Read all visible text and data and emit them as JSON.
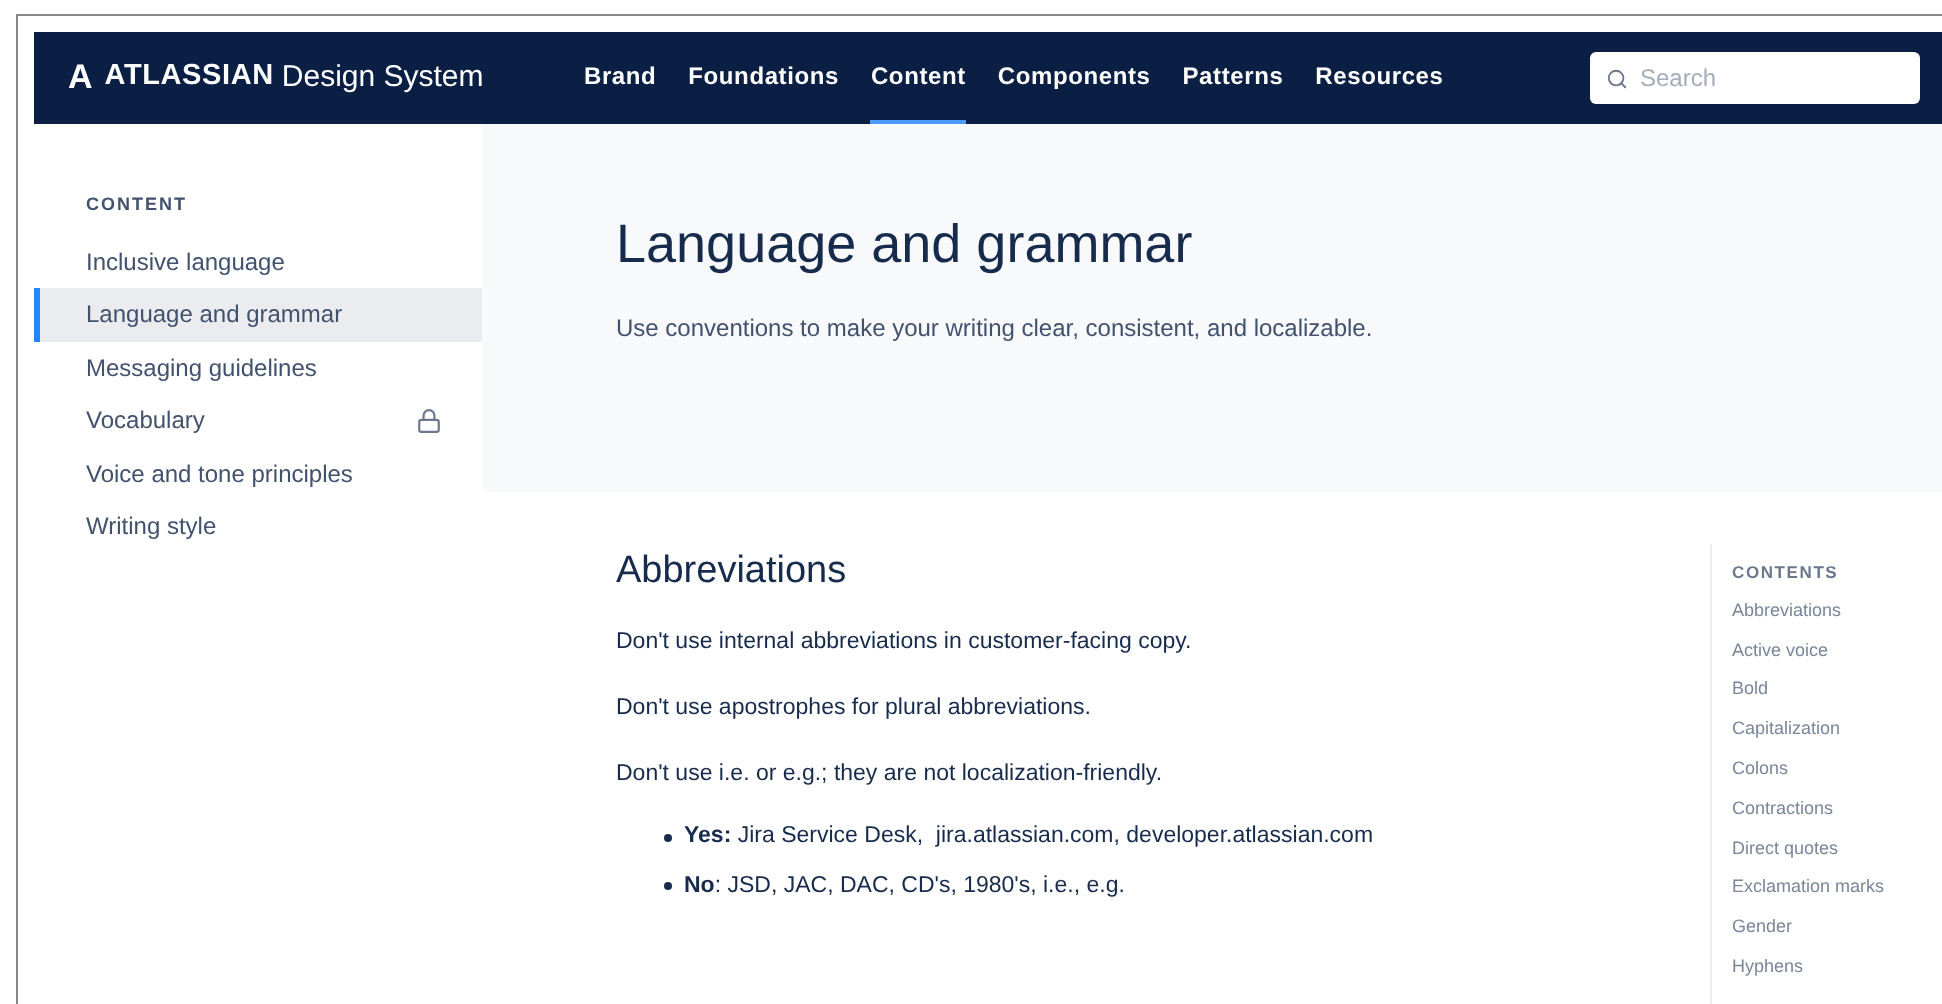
{
  "logo": {
    "mark": "A",
    "brand": "ATLASSIAN",
    "product": "Design System"
  },
  "nav": [
    {
      "label": "Brand",
      "selected": false
    },
    {
      "label": "Foundations",
      "selected": false
    },
    {
      "label": "Content",
      "selected": true
    },
    {
      "label": "Components",
      "selected": false
    },
    {
      "label": "Patterns",
      "selected": false
    },
    {
      "label": "Resources",
      "selected": false
    }
  ],
  "search": {
    "placeholder": "Search"
  },
  "sidebar": {
    "heading": "CONTENT",
    "items": [
      {
        "label": "Inclusive language",
        "selected": false,
        "locked": false
      },
      {
        "label": "Language and grammar",
        "selected": true,
        "locked": false
      },
      {
        "label": "Messaging guidelines",
        "selected": false,
        "locked": false
      },
      {
        "label": "Vocabulary",
        "selected": false,
        "locked": true
      },
      {
        "label": "Voice and tone principles",
        "selected": false,
        "locked": false
      },
      {
        "label": "Writing style",
        "selected": false,
        "locked": false
      }
    ]
  },
  "header": {
    "title": "Language and grammar",
    "subtitle": "Use conventions to make your writing clear, consistent, and localizable."
  },
  "section": {
    "heading": "Abbreviations",
    "paragraphs": [
      "Don't use internal abbreviations in customer-facing copy.",
      "Don't use apostrophes for plural abbreviations.",
      "Don't use i.e. or e.g.; they are not localization-friendly."
    ],
    "bullets": [
      "**Yes:** Jira Service Desk,  jira.atlassian.com, developer.atlassian.com",
      "**No**: JSD, JAC, DAC, CD's, 1980's, i.e., e.g."
    ]
  },
  "toc": {
    "heading": "CONTENTS",
    "items": [
      "Abbreviations",
      "Active voice",
      "Bold",
      "Capitalization",
      "Colons",
      "Contractions",
      "Direct quotes",
      "Exclamation marks",
      "Gender",
      "Hyphens"
    ]
  }
}
